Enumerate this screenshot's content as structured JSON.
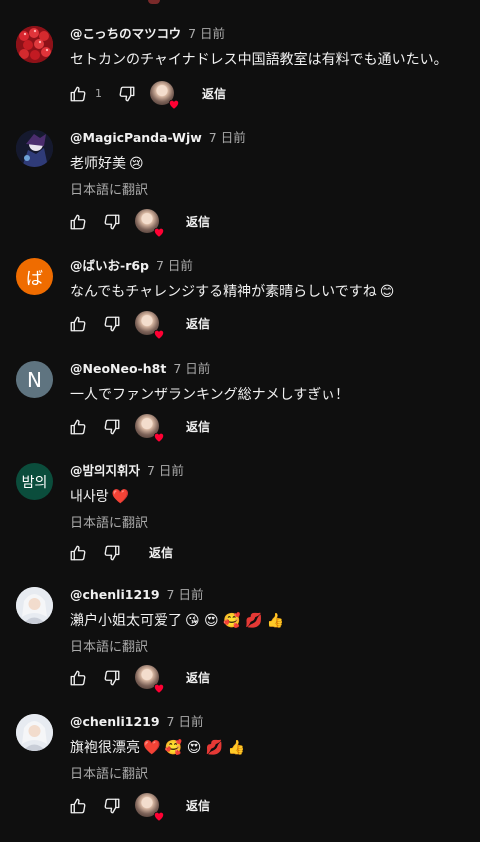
{
  "comments": [
    {
      "username": "@こっちのマツコウ",
      "time": "7 日前",
      "text": "セトカンのチャイナドレス中国語教室は有料でも通いたい。",
      "emoji": "",
      "translate": "",
      "likes": "1",
      "reply": "返信"
    },
    {
      "username": "@MagicPanda-Wjw",
      "time": "7 日前",
      "text": "老师好美",
      "emoji": "😢",
      "translate": "日本語に翻訳",
      "likes": "",
      "reply": "返信"
    },
    {
      "username": "@ばいお-r6p",
      "time": "7 日前",
      "text": "なんでもチャレンジする精神が素晴らしいですね",
      "emoji": "😊",
      "translate": "",
      "likes": "",
      "reply": "返信",
      "avatar_letter": "ば",
      "avatar_color": "#ef6c00"
    },
    {
      "username": "@NeoNeo-h8t",
      "time": "7 日前",
      "text": "一人でファンザランキング総ナメしすぎぃ！",
      "emoji": "",
      "translate": "",
      "likes": "",
      "reply": "返信",
      "avatar_letter": "N",
      "avatar_color": "#5f7480"
    },
    {
      "username": "@밤의지휘자",
      "time": "7 日前",
      "text": "내사랑",
      "emoji": "❤️",
      "translate": "日本語に翻訳",
      "likes": "",
      "reply": "返信",
      "avatar_letter": "밤의",
      "avatar_color": "#0b4d3c"
    },
    {
      "username": "@chenli1219",
      "time": "7 日前",
      "text": "瀨户小姐太可爱了",
      "emoji": "😘 😍 🥰 💋 👍",
      "translate": "日本語に翻訳",
      "likes": "",
      "reply": "返信"
    },
    {
      "username": "@chenli1219",
      "time": "7 日前",
      "text": "旗袍很漂亮",
      "emoji": "❤️ 🥰 😍 💋 👍",
      "translate": "日本語に翻訳",
      "likes": "",
      "reply": "返信"
    }
  ],
  "icons": {
    "like": "thumb-up-icon",
    "dislike": "thumb-down-icon",
    "creator_heart": "creator-heart-icon"
  },
  "colors": {
    "background": "#0f0f0f",
    "text": "#f1f1f1",
    "secondary": "#aaaaaa",
    "heart": "#ff0033"
  }
}
